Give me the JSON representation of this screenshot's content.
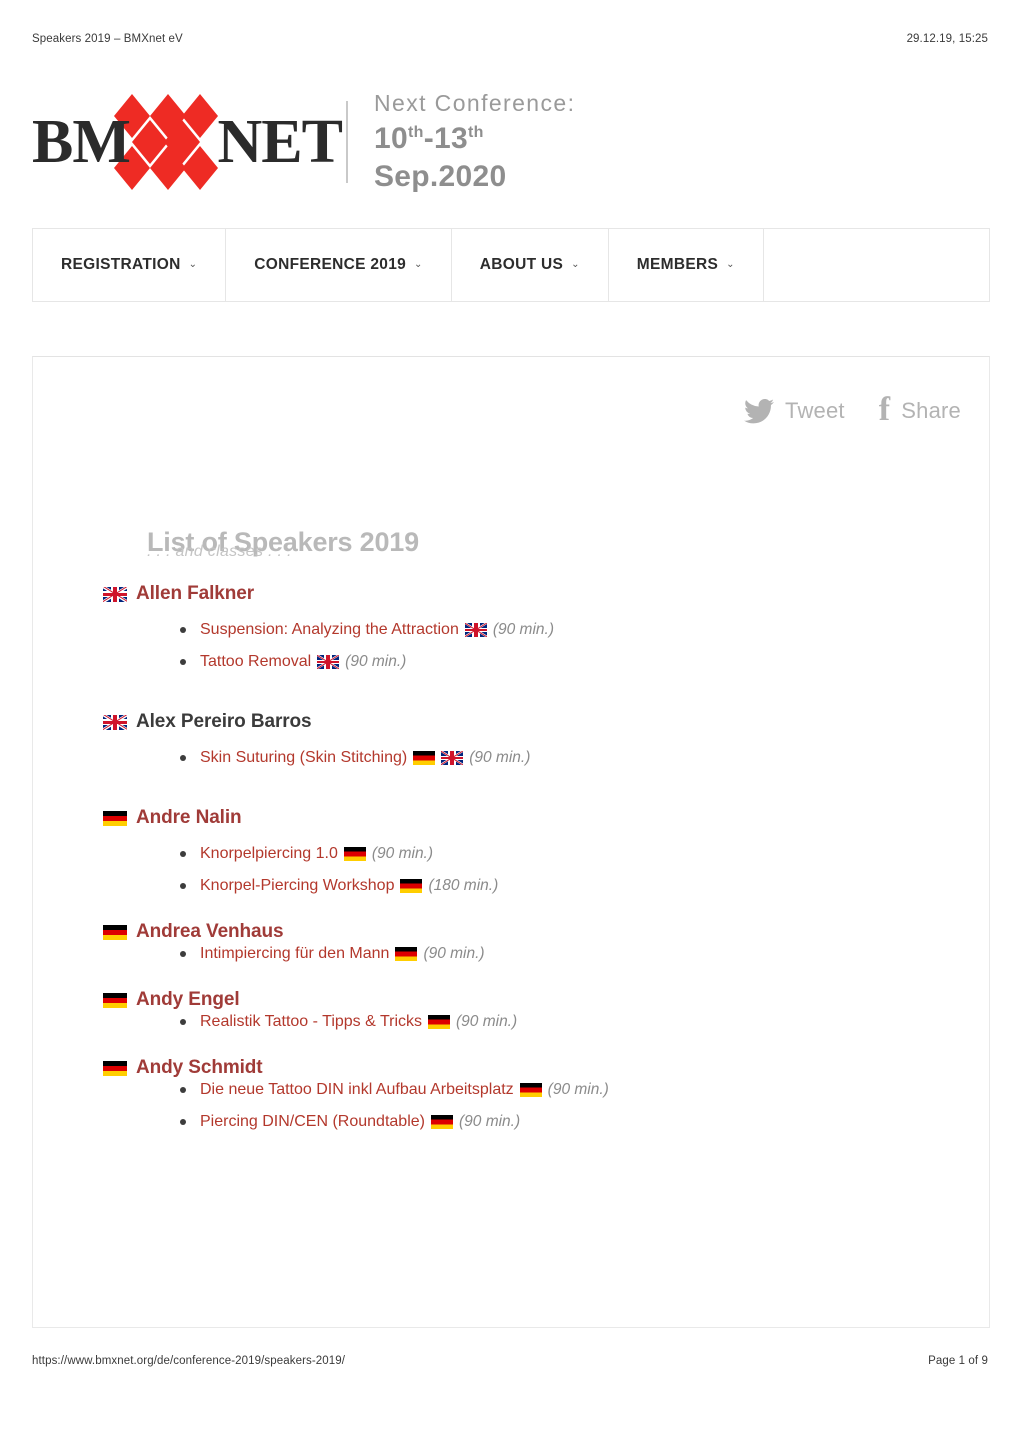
{
  "print": {
    "header_title": "Speakers 2019 – BMXnet eV",
    "header_timestamp": "29.12.19, 15:25",
    "footer_url": "https://www.bmxnet.org/de/conference-2019/speakers-2019/",
    "footer_page": "Page 1 of 9"
  },
  "logo": {
    "word_1": "BM",
    "word_gap": "XX",
    "word_2": "NET",
    "tagline_1": "Next Conference:",
    "tagline_day_from": "10",
    "tagline_sup_from": "th",
    "tagline_dash": "-",
    "tagline_day_to": "13",
    "tagline_sup_to": "th",
    "tagline_month": " Sep.2020",
    "accent_color": "#ee2b24"
  },
  "nav": {
    "items": [
      {
        "label": "REGISTRATION",
        "caret": "⌄"
      },
      {
        "label": "CONFERENCE 2019",
        "caret": "⌄"
      },
      {
        "label": "ABOUT US",
        "caret": "⌄"
      },
      {
        "label": "MEMBERS",
        "caret": "⌄"
      }
    ]
  },
  "share": {
    "tweet_label": "Tweet",
    "facebook_label": "Share",
    "facebook_glyph": "f",
    "color": "#b3b3b3"
  },
  "page": {
    "title": "List of Speakers 2019",
    "subtitle": ". . . and classes . . ."
  },
  "colors": {
    "speaker_name": "#a03b38",
    "class_title": "#b3382c",
    "duration": "#8b8b8b",
    "title_gray": "#b9b9b9"
  },
  "speakers": [
    {
      "name": "Allen Falkner",
      "flag": "gb",
      "is_link": true,
      "classes": [
        {
          "title": "Suspension: Analyzing the Attraction",
          "flags": [
            "gb"
          ],
          "duration": "(90 min.)"
        },
        {
          "title": "Tattoo Removal",
          "flags": [
            "gb"
          ],
          "duration": "(90 min.)"
        }
      ]
    },
    {
      "name": "Alex Pereiro Barros",
      "flag": "gb",
      "is_link": false,
      "classes": [
        {
          "title": "Skin Suturing (Skin Stitching)",
          "flags": [
            "de",
            "gb"
          ],
          "duration": "(90 min.)"
        }
      ]
    },
    {
      "name": "Andre Nalin",
      "flag": "de",
      "is_link": true,
      "classes": [
        {
          "title": "Knorpelpiercing 1.0",
          "flags": [
            "de"
          ],
          "duration": "(90  min.)"
        },
        {
          "title": "Knorpel-Piercing Workshop",
          "flags": [
            "de"
          ],
          "duration": "(180  min.)"
        }
      ]
    },
    {
      "name": "Andrea Venhaus",
      "flag": "de",
      "is_link": true,
      "classes": [
        {
          "title": "Intimpiercing für den Mann",
          "flags": [
            "de"
          ],
          "duration": "(90  min.)"
        }
      ]
    },
    {
      "name": "Andy Engel",
      "flag": "de",
      "is_link": true,
      "classes": [
        {
          "title": "Realistik Tattoo - Tipps & Tricks",
          "flags": [
            "de"
          ],
          "duration": "(90  min.)"
        }
      ]
    },
    {
      "name": "Andy Schmidt",
      "flag": "de",
      "is_link": true,
      "classes": [
        {
          "title": "Die neue Tattoo DIN inkl Aufbau Arbeitsplatz",
          "flags": [
            "de"
          ],
          "duration": "(90  min.)"
        },
        {
          "title": "Piercing DIN/CEN (Roundtable)",
          "flags": [
            "de"
          ],
          "duration": "(90  min.)"
        }
      ]
    }
  ]
}
